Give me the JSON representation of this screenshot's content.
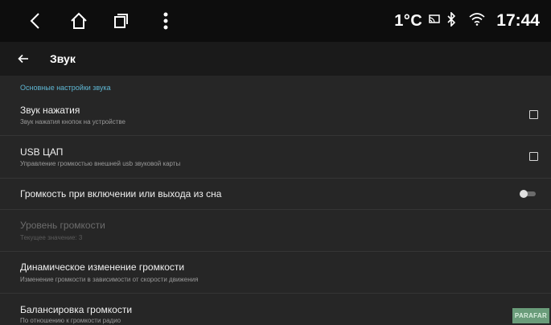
{
  "status_bar": {
    "temperature": "1°C",
    "time": "17:44",
    "icons": [
      "back-icon",
      "home-icon",
      "recents-icon",
      "menu-icon",
      "cast-icon",
      "bluetooth-icon",
      "wifi-icon"
    ]
  },
  "app_bar": {
    "title": "Звук"
  },
  "section": {
    "header": "Основные настройки звука"
  },
  "settings": [
    {
      "title": "Звук нажатия",
      "subtitle": "Звук нажатия кнопок на устройстве",
      "control": "checkbox",
      "checked": false
    },
    {
      "title": "USB ЦАП",
      "subtitle": "Управление громкостью внешней usb звуковой карты",
      "control": "checkbox",
      "checked": false
    },
    {
      "title": "Громкость при включении или выхода из сна",
      "subtitle": "",
      "control": "switch",
      "on": false
    },
    {
      "title": "Уровень громкости",
      "subtitle": "Текущее значение: 3",
      "control": "none",
      "enabled": false
    },
    {
      "title": "Динамическое изменение громкости",
      "subtitle": "Изменение громкости в зависимости от скорости движения",
      "control": "none"
    },
    {
      "title": "Балансировка громкости",
      "subtitle": "По отношению к громкости радио",
      "control": "none"
    }
  ],
  "watermark": "PARAFAR",
  "colors": {
    "accent": "#5fb7d4",
    "status_bar_bg": "#0d0d0d",
    "app_bar_bg": "#1a1a1a",
    "list_bg": "#262626"
  }
}
